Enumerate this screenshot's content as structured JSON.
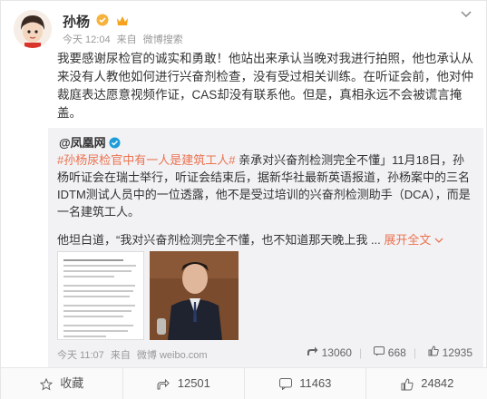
{
  "post": {
    "username": "孙杨",
    "time": "今天 12:04",
    "from": "来自",
    "source": "微博搜索",
    "text": "我要感谢尿检官的诚实和勇敢！他站出来承认当晚对我进行拍照，他也承认从来没有人教他如何进行兴奋剂检查，没有受过相关训练。在听证会前，他对仲裁庭表达愿意视频作证，CAS却没有联系他。但是，真相永远不会被谎言掩盖。"
  },
  "repost": {
    "name": "@凤凰网",
    "topic": "#孙杨尿检官中有一人是建筑工人#",
    "text": " 亲承对兴奋剂检测完全不懂」11月18日，孙杨听证会在瑞士举行，听证会结束后，据新华社最新英语报道，孙杨案中的三名IDTM测试人员中的一位透露，他不是受过培训的兴奋剂检测助手（DCA），而是一名建筑工人。",
    "text2": "他坦白道，“我对兴奋剂检测完全不懂，也不知道那天晚上我 ...",
    "expand_label": "展开全文",
    "time": "今天 11:07",
    "from": "来自",
    "source": "微博 weibo.com",
    "repost_count": "13060",
    "comment_count": "668",
    "like_count": "12935"
  },
  "footer": {
    "favorite_label": "收藏",
    "repost_count": "12501",
    "comment_count": "11463",
    "like_count": "24842"
  }
}
